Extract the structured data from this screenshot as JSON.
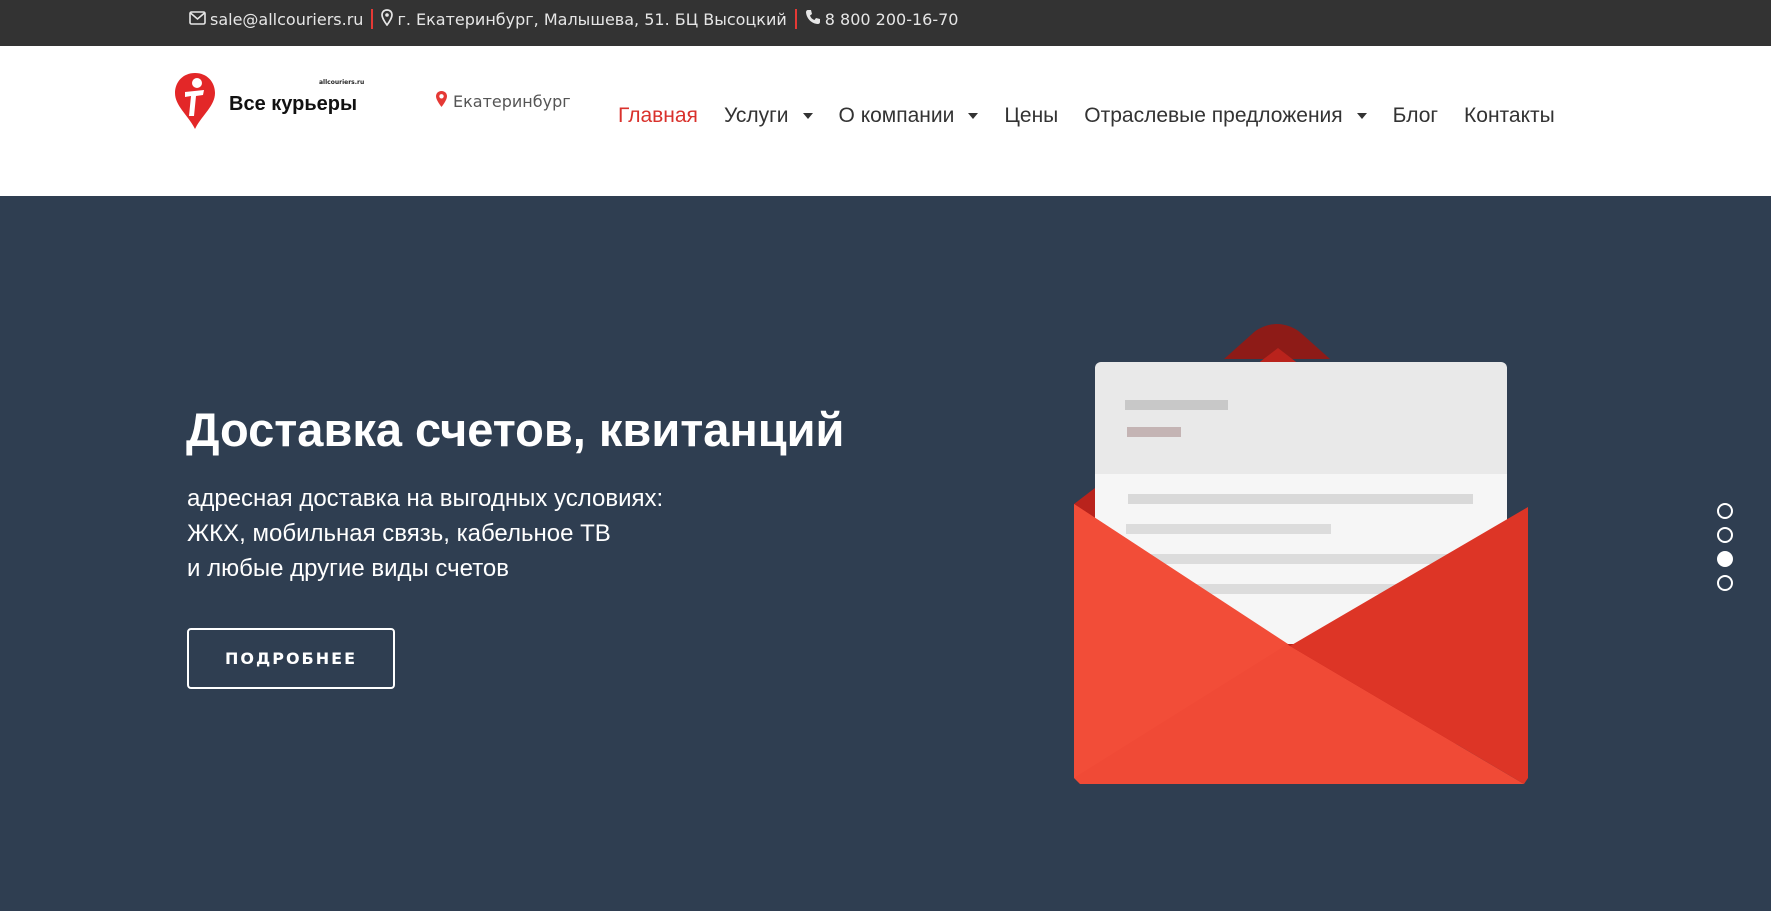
{
  "topbar": {
    "email": "sale@allcouriers.ru",
    "email_icon": "envelope-icon",
    "address": "г. Екатеринбург, Малышева, 51. БЦ Высоцкий",
    "address_icon": "map-marker-icon",
    "phone": "8 800 200-16-70",
    "phone_icon": "phone-icon"
  },
  "header": {
    "logo_small": "allcouriers.ru",
    "logo_text": "Все курьеры",
    "city": "Екатеринбург",
    "city_icon": "map-marker-icon"
  },
  "nav": {
    "items": [
      {
        "label": "Главная",
        "active": true,
        "dropdown": false
      },
      {
        "label": "Услуги",
        "active": false,
        "dropdown": true
      },
      {
        "label": "О компании",
        "active": false,
        "dropdown": true
      },
      {
        "label": "Цены",
        "active": false,
        "dropdown": false
      },
      {
        "label": "Отраслевые предложения",
        "active": false,
        "dropdown": true
      },
      {
        "label": "Блог",
        "active": false,
        "dropdown": false
      },
      {
        "label": "Контакты",
        "active": false,
        "dropdown": false
      }
    ]
  },
  "hero": {
    "title": "Доставка счетов, квитанций",
    "subtitle_lines": [
      "адресная доставка на выгодных условиях:",
      "ЖКХ, мобильная связь, кабельное ТВ",
      "и любые другие виды счетов"
    ],
    "button_label": "ПОДРОБНЕЕ",
    "image_icon": "envelope-illustration"
  },
  "slider": {
    "total": 4,
    "active_index": 2
  },
  "colors": {
    "topbar_bg": "#333333",
    "hero_bg": "#2f3e51",
    "accent": "#d9312c",
    "envelope_red": "#f04a36"
  }
}
